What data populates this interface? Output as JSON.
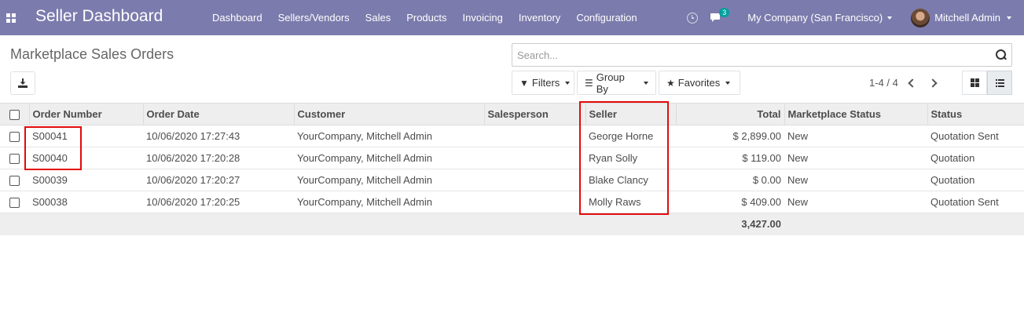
{
  "navbar": {
    "brand": "Seller Dashboard",
    "menu": [
      "Dashboard",
      "Sellers/Vendors",
      "Sales",
      "Products",
      "Invoicing",
      "Inventory",
      "Configuration"
    ],
    "chat_badge": "3",
    "company": "My Company (San Francisco)",
    "user": "Mitchell Admin",
    "color": "#7c7bad"
  },
  "control": {
    "breadcrumb": "Marketplace Sales Orders",
    "search_placeholder": "Search...",
    "filters": "Filters",
    "group_by": "Group By",
    "favorites": "Favorites",
    "pager": "1-4 / 4"
  },
  "table": {
    "columns": [
      "Order Number",
      "Order Date",
      "Customer",
      "Salesperson",
      "Seller",
      "Total",
      "Marketplace Status",
      "Status"
    ],
    "rows": [
      [
        "S00041",
        "10/06/2020 17:27:43",
        "YourCompany, Mitchell Admin",
        "",
        "George Horne",
        "$ 2,899.00",
        "New",
        "Quotation Sent"
      ],
      [
        "S00040",
        "10/06/2020 17:20:28",
        "YourCompany, Mitchell Admin",
        "",
        "Ryan Solly",
        "$ 119.00",
        "New",
        "Quotation"
      ],
      [
        "S00039",
        "10/06/2020 17:20:27",
        "YourCompany, Mitchell Admin",
        "",
        "Blake Clancy",
        "$ 0.00",
        "New",
        "Quotation"
      ],
      [
        "S00038",
        "10/06/2020 17:20:25",
        "YourCompany, Mitchell Admin",
        "",
        "Molly Raws",
        "$ 409.00",
        "New",
        "Quotation Sent"
      ]
    ],
    "total": "3,427.00"
  },
  "highlight_color": "#e20b0b"
}
